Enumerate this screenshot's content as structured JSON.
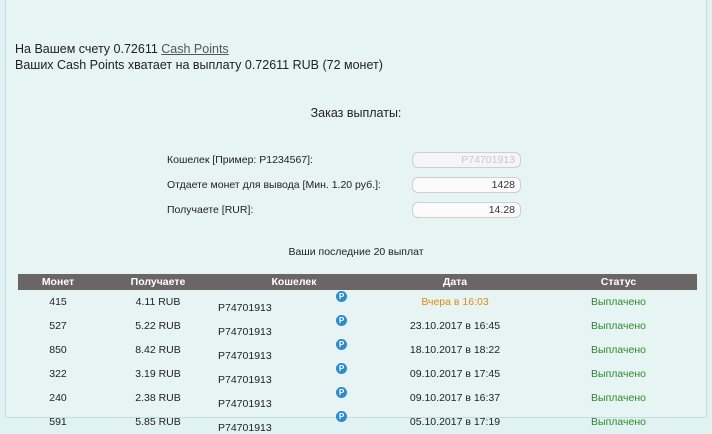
{
  "balance": {
    "line1_prefix": "На Вашем счету 0.72611 ",
    "line1_link": "Cash Points",
    "line2": "Ваших Cash Points хватает на выплату 0.72611 RUB (72 монет)"
  },
  "form": {
    "title": "Заказ выплаты:",
    "wallet_label": "Кошелек [Пример: P1234567]:",
    "wallet_value": "P74701913",
    "coins_label": "Отдаете монет для вывода [Мин. 1.20 руб.]:",
    "coins_value": "1428",
    "receive_label": "Получаете [RUR]:",
    "receive_value": "14.28"
  },
  "payouts": {
    "title": "Ваши последние 20 выплат",
    "headers": [
      "Монет",
      "Получаете",
      "Кошелек",
      "Дата",
      "Статус"
    ],
    "icon": "payeer-icon",
    "rows": [
      {
        "coins": "415",
        "amount": "4.11 RUB",
        "wallet": "P74701913",
        "date": "Вчера в 16:03",
        "status": "Выплачено"
      },
      {
        "coins": "527",
        "amount": "5.22 RUB",
        "wallet": "P74701913",
        "date": "23.10.2017 в 16:45",
        "status": "Выплачено"
      },
      {
        "coins": "850",
        "amount": "8.42 RUB",
        "wallet": "P74701913",
        "date": "18.10.2017 в 18:22",
        "status": "Выплачено"
      },
      {
        "coins": "322",
        "amount": "3.19 RUB",
        "wallet": "P74701913",
        "date": "09.10.2017 в 17:45",
        "status": "Выплачено"
      },
      {
        "coins": "240",
        "amount": "2.38 RUB",
        "wallet": "P74701913",
        "date": "09.10.2017 в 16:37",
        "status": "Выплачено"
      },
      {
        "coins": "591",
        "amount": "5.85 RUB",
        "wallet": "P74701913",
        "date": "05.10.2017 в 17:19",
        "status": "Выплачено"
      }
    ]
  },
  "colors": {
    "background": "#e0f2f1",
    "table_header": "#6b6665",
    "status_ok": "#2e8b2e",
    "date_recent": "#e08a13",
    "icon": "#2b8cd6"
  }
}
